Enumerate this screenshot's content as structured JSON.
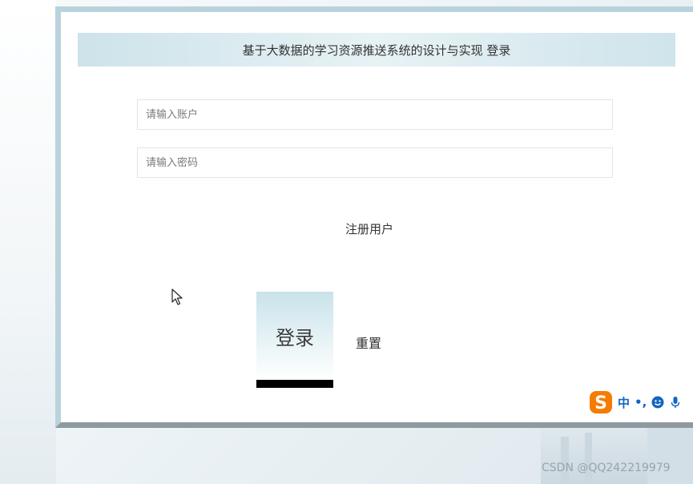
{
  "header": {
    "title": "基于大数据的学习资源推送系统的设计与实现 登录"
  },
  "form": {
    "account_placeholder": "请输入账户",
    "account_value": "",
    "password_placeholder": "请输入密码",
    "password_value": "",
    "register_label": "注册用户",
    "login_label": "登录",
    "reset_label": "重置"
  },
  "ime": {
    "mode_label": "中",
    "punct_label": "•,",
    "logo_icon": "sogou-s-icon",
    "emoji_icon": "smiley-icon",
    "mic_icon": "microphone-icon"
  },
  "watermark": {
    "text": "CSDN @QQ242219979"
  },
  "colors": {
    "panel_border": "#b9d3dc",
    "panel_shadow": "#8e9a9f",
    "header_bg": "#cde3ea",
    "login_underline": "#000000",
    "ime_blue": "#1565c0",
    "ime_orange": "#f57c00"
  }
}
